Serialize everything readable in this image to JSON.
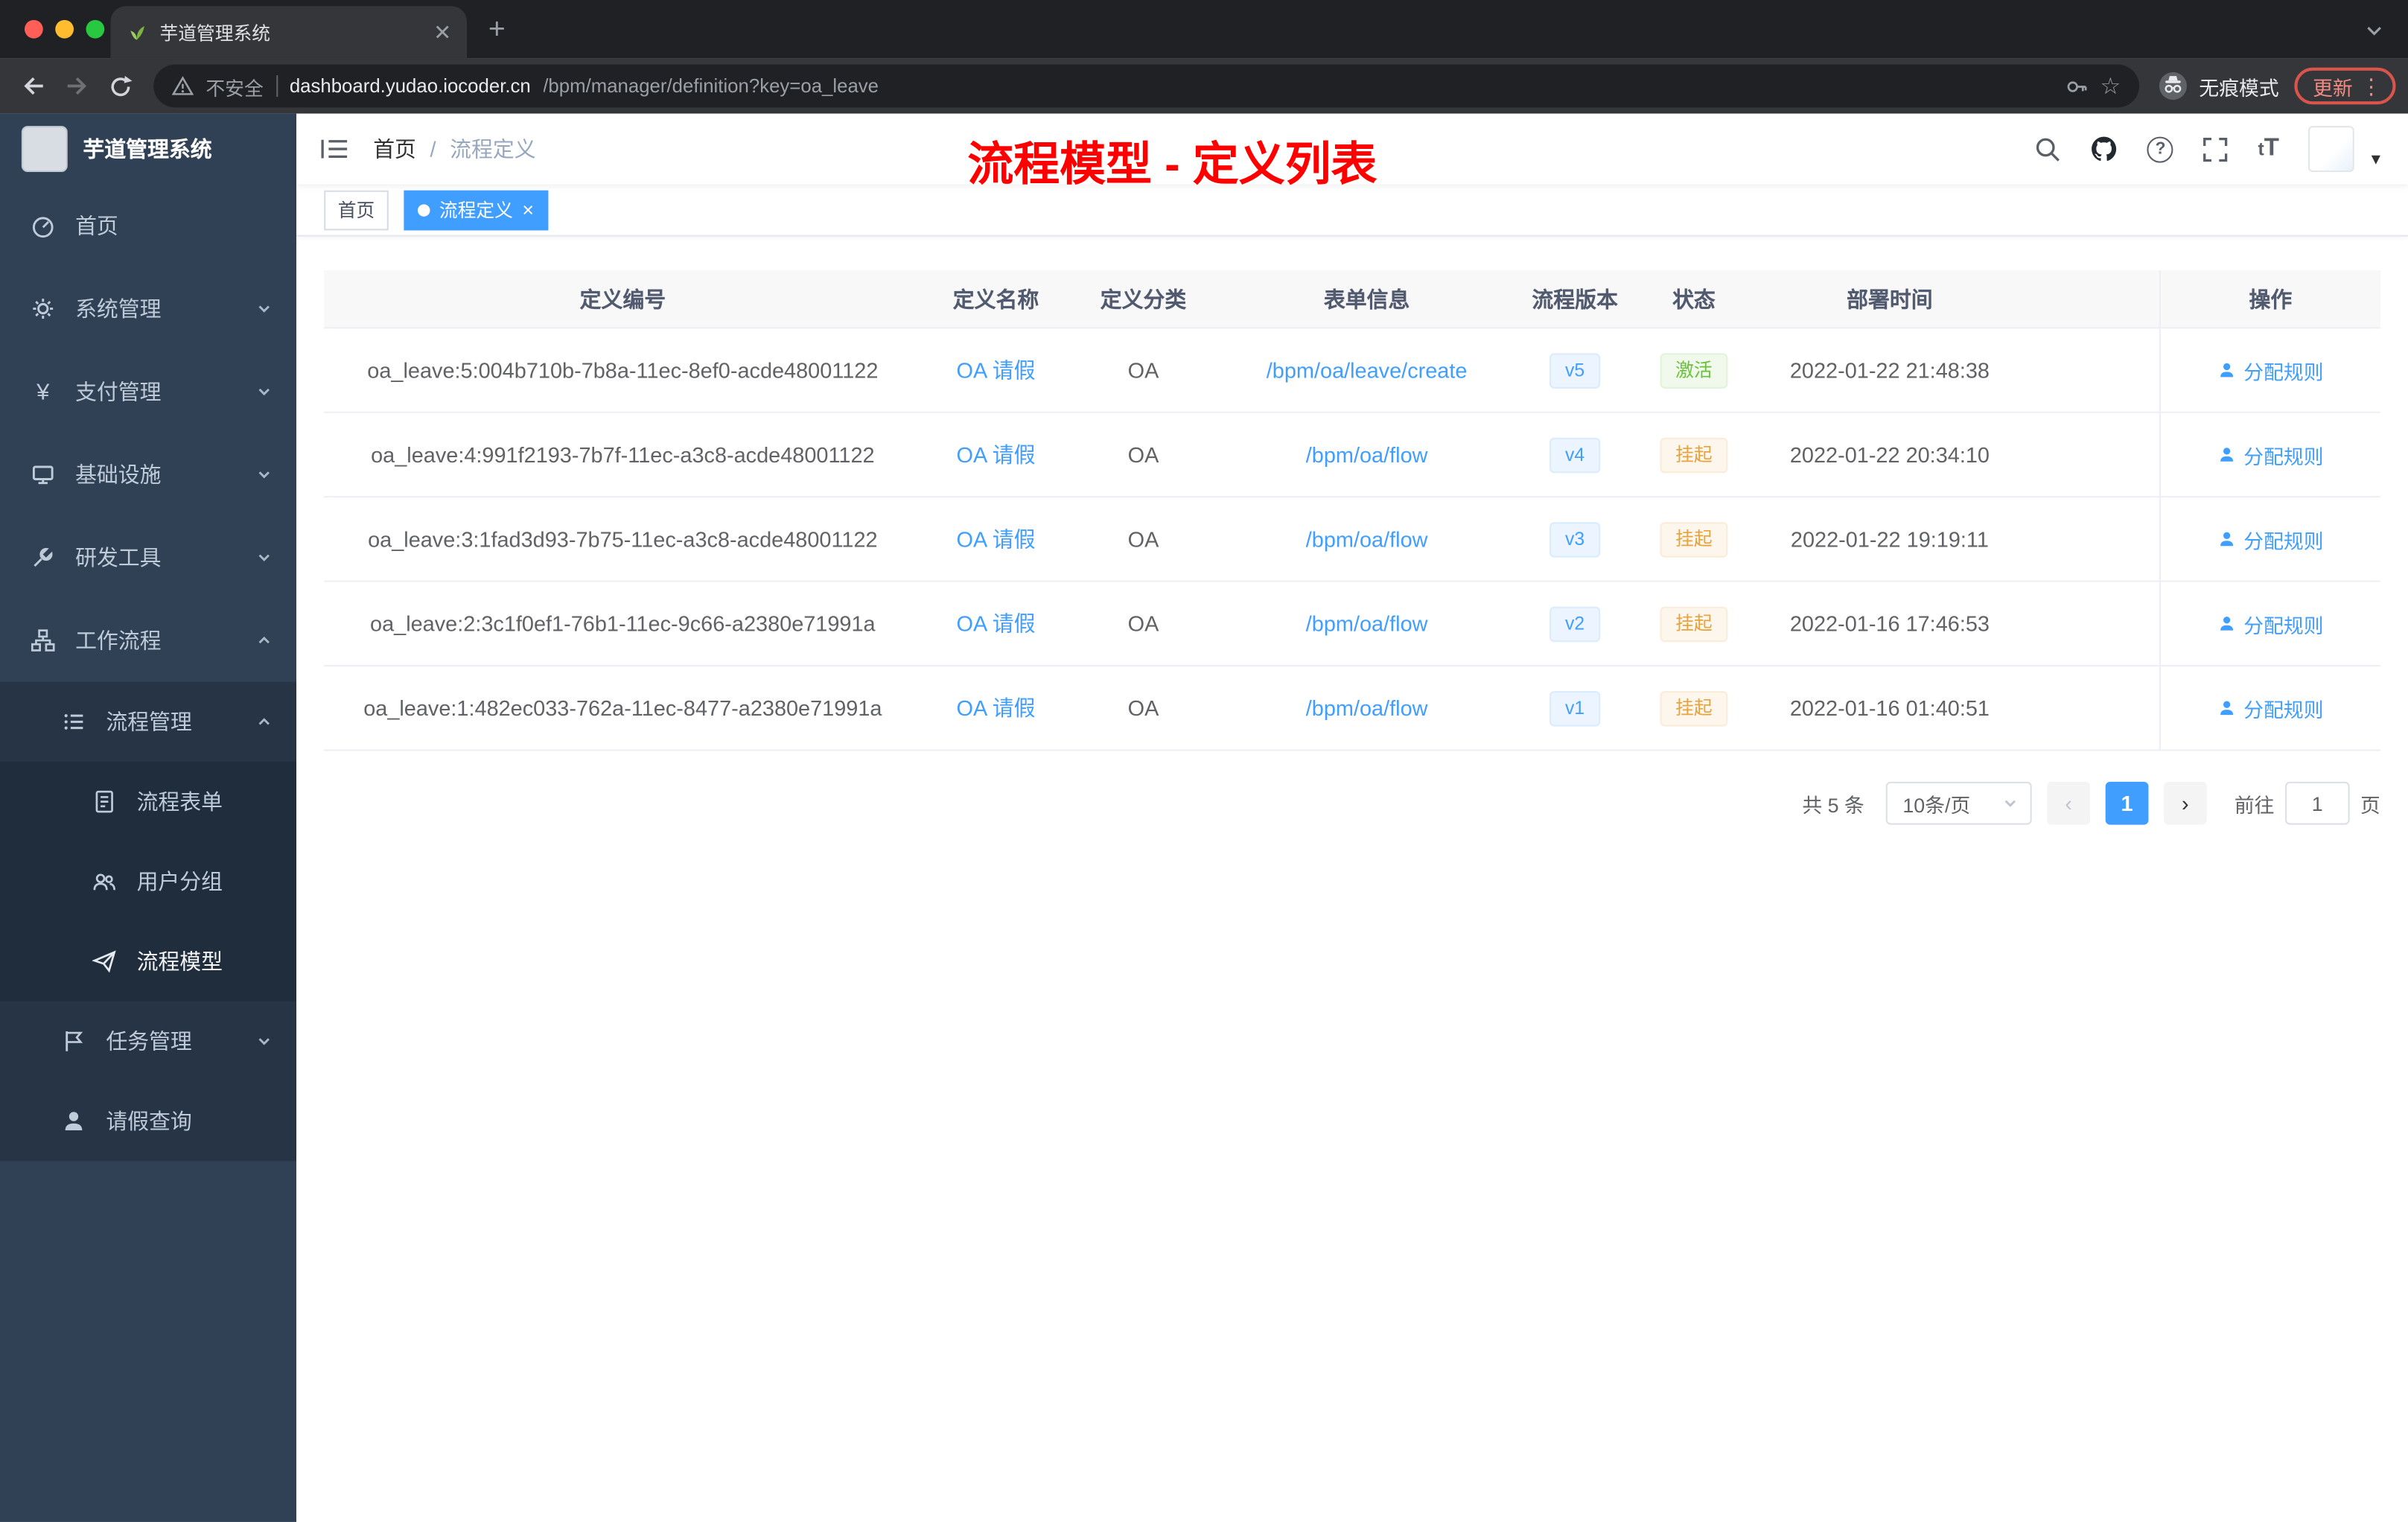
{
  "browser": {
    "tab_title": "芋道管理系统",
    "security_label": "不安全",
    "url_host": "dashboard.yudao.iocoder.cn",
    "url_path": "/bpm/manager/definition?key=oa_leave",
    "incognito_label": "无痕模式",
    "update_label": "更新"
  },
  "sidebar": {
    "logo_title": "芋道管理系统",
    "items": [
      {
        "label": "首页"
      },
      {
        "label": "系统管理"
      },
      {
        "label": "支付管理"
      },
      {
        "label": "基础设施"
      },
      {
        "label": "研发工具"
      },
      {
        "label": "工作流程"
      },
      {
        "label": "流程管理"
      },
      {
        "label": "流程表单"
      },
      {
        "label": "用户分组"
      },
      {
        "label": "流程模型"
      },
      {
        "label": "任务管理"
      },
      {
        "label": "请假查询"
      }
    ]
  },
  "header": {
    "breadcrumb_home": "首页",
    "breadcrumb_sep": "/",
    "breadcrumb_current": "流程定义",
    "annotation": "流程模型 - 定义列表",
    "annotation_color": "#ff0000"
  },
  "tags": {
    "home": "首页",
    "active": "流程定义"
  },
  "table": {
    "columns": [
      "定义编号",
      "定义名称",
      "定义分类",
      "表单信息",
      "流程版本",
      "状态",
      "部署时间",
      "操作"
    ],
    "rows": [
      {
        "id": "oa_leave:5:004b710b-7b8a-11ec-8ef0-acde48001122",
        "name": "OA 请假",
        "category": "OA",
        "form": "/bpm/oa/leave/create",
        "version": "v5",
        "status": "激活",
        "time": "2022-01-22 21:48:38",
        "action": "分配规则"
      },
      {
        "id": "oa_leave:4:991f2193-7b7f-11ec-a3c8-acde48001122",
        "name": "OA 请假",
        "category": "OA",
        "form": "/bpm/oa/flow",
        "version": "v4",
        "status": "挂起",
        "time": "2022-01-22 20:34:10",
        "action": "分配规则"
      },
      {
        "id": "oa_leave:3:1fad3d93-7b75-11ec-a3c8-acde48001122",
        "name": "OA 请假",
        "category": "OA",
        "form": "/bpm/oa/flow",
        "version": "v3",
        "status": "挂起",
        "time": "2022-01-22 19:19:11",
        "action": "分配规则"
      },
      {
        "id": "oa_leave:2:3c1f0ef1-76b1-11ec-9c66-a2380e71991a",
        "name": "OA 请假",
        "category": "OA",
        "form": "/bpm/oa/flow",
        "version": "v2",
        "status": "挂起",
        "time": "2022-01-16 17:46:53",
        "action": "分配规则"
      },
      {
        "id": "oa_leave:1:482ec033-762a-11ec-8477-a2380e71991a",
        "name": "OA 请假",
        "category": "OA",
        "form": "/bpm/oa/flow",
        "version": "v1",
        "status": "挂起",
        "time": "2022-01-16 01:40:51",
        "action": "分配规则"
      }
    ]
  },
  "pagination": {
    "total": "共 5 条",
    "page_size": "10条/页",
    "page": "1",
    "goto_label": "前往",
    "goto_value": "1",
    "goto_unit": "页"
  },
  "colors": {
    "accent_blue": "#409eff",
    "status_active_green": "#67c23a",
    "status_suspended_orange": "#e6a23c",
    "sidebar_bg": "#304156",
    "annotation_red": "#ff0000"
  }
}
